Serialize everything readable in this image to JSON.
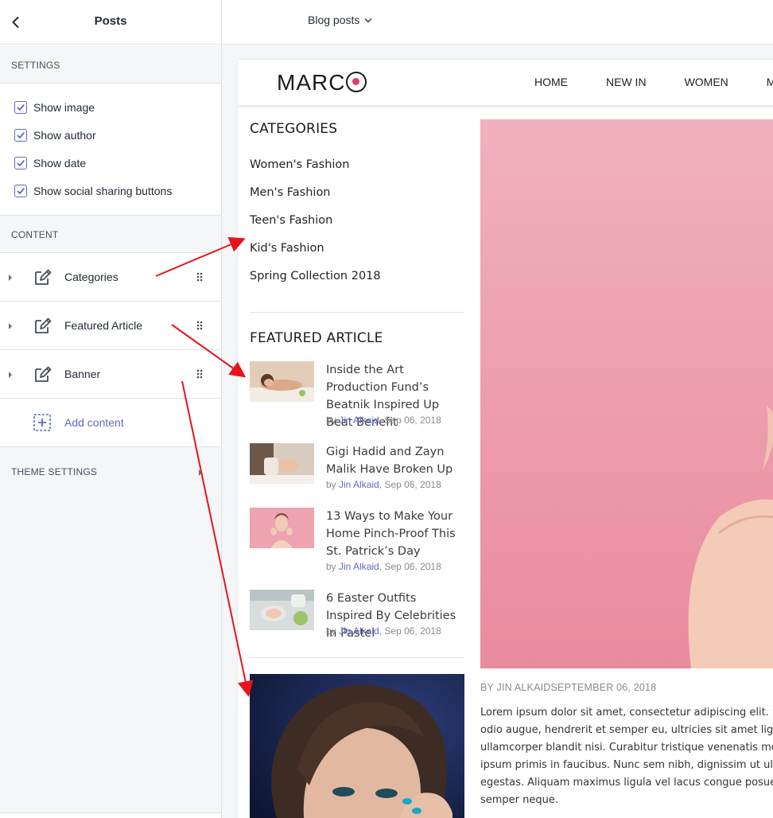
{
  "sidebar": {
    "title": "Posts",
    "settings_label": "SETTINGS",
    "settings": [
      {
        "label": "Show image",
        "checked": true
      },
      {
        "label": "Show author",
        "checked": true
      },
      {
        "label": "Show date",
        "checked": true
      },
      {
        "label": "Show social sharing buttons",
        "checked": true
      }
    ],
    "content_label": "CONTENT",
    "content_items": [
      {
        "label": "Categories"
      },
      {
        "label": "Featured Article"
      },
      {
        "label": "Banner"
      }
    ],
    "add_content": "Add content",
    "theme_settings": "THEME SETTINGS"
  },
  "topbar": {
    "page_select": "Blog posts"
  },
  "site": {
    "logo": {
      "prefix": "MARC"
    },
    "nav": [
      "HOME",
      "NEW IN",
      "WOMEN",
      "M"
    ],
    "categories_heading": "CATEGORIES",
    "categories": [
      "Women's Fashion",
      "Men's Fashion",
      "Teen's Fashion",
      "Kid's Fashion",
      "Spring Collection 2018"
    ],
    "featured_heading": "FEATURED ARTICLE",
    "featured": [
      {
        "title": "Inside the Art Production Fund’s Beatnik Inspired Up Beat Benefit",
        "by": "by ",
        "author": "Jin Alkaid",
        "date": ", Sep 06, 2018"
      },
      {
        "title": "Gigi Hadid and Zayn Malik Have Broken Up",
        "by": "by ",
        "author": "Jin Alkaid",
        "date": ", Sep 06, 2018"
      },
      {
        "title": "13 Ways to Make Your Home Pinch-Proof This St. Patrick’s Day",
        "by": "by ",
        "author": "Jin Alkaid",
        "date": ", Sep 06, 2018"
      },
      {
        "title": "6 Easter Outfits Inspired By Celebrities In Pastel",
        "by": "by ",
        "author": "Jin Alkaid",
        "date": ", Sep 06, 2018"
      }
    ],
    "post_meta": "BY JIN ALKAIDSEPTEMBER 06, 2018",
    "post_body": "Lorem ipsum dolor sit amet, consectetur adipiscing elit. Sed odio augue, hendrerit et semper eu, ultricies sit amet ligula ullamcorper blandit nisi. Curabitur tristique venenatis mollis ipsum primis in faucibus. Nunc sem nibh, dignissim ut ultrices egestas. Aliquam maximus ligula vel lacus congue posuere semper neque."
  },
  "colors": {
    "accent": "#5c6ac4",
    "annotation_arrow": "#e8141b",
    "hero_pink": "#ec9aac"
  }
}
